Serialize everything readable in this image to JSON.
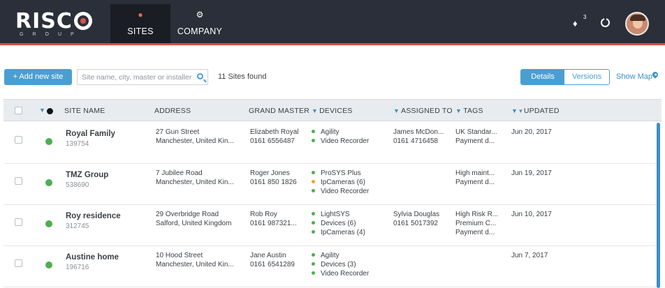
{
  "brand": {
    "logo_text": "RISC",
    "logo_sub": "GROUP"
  },
  "nav": {
    "tabs": [
      {
        "label": "SITES",
        "icon": "map-pin-icon",
        "active": true
      },
      {
        "label": "COMPANY",
        "icon": "gear-icon",
        "active": false
      }
    ],
    "notifications_count": "3"
  },
  "toolbar": {
    "add_label": "+ Add new site",
    "search_placeholder": "Site name, city, master or installer",
    "sites_found": "11 Sites found",
    "details_label": "Details",
    "versions_label": "Versions",
    "show_map_label": "Show Map"
  },
  "table": {
    "headers": {
      "site_name": "SITE NAME",
      "address": "ADDRESS",
      "grand_master": "GRAND MASTER",
      "devices": "DEVICES",
      "assigned_to": "ASSIGNED TO",
      "tags": "TAGS",
      "updated": "UPDATED"
    },
    "rows": [
      {
        "name": "Royal Family",
        "id": "139754",
        "address1": "27 Gun Street",
        "address2": "Manchester, United Kin...",
        "master_name": "Elizabeth Royal",
        "master_phone": "0161 6556487",
        "devices": [
          "Agility",
          "Video Recorder"
        ],
        "assigned_name": "James McDon...",
        "assigned_phone": "0161 4716458",
        "tags": [
          "UK Standar...",
          "Payment d..."
        ],
        "updated": "Jun 20, 2017"
      },
      {
        "name": "TMZ Group",
        "id": "538690",
        "address1": "7 Jubilee Road",
        "address2": "Manchester, United Kin...",
        "master_name": "Roger Jones",
        "master_phone": "0161 850 1826",
        "devices": [
          "ProSYS Plus",
          "IpCameras (6)",
          "Video Recorder"
        ],
        "assigned_name": "",
        "assigned_phone": "",
        "tags": [
          "High maint...",
          "Payment d..."
        ],
        "updated": "Jun 19, 2017"
      },
      {
        "name": "Roy residence",
        "id": "312745",
        "address1": "29 Overbridge Road",
        "address2": "Salford, United Kingdom",
        "master_name": "Rob Roy",
        "master_phone": "0161 987321...",
        "devices": [
          "LightSYS",
          "Devices (6)",
          "IpCameras (4)"
        ],
        "assigned_name": "Sylvia Douglas",
        "assigned_phone": "0161 5017392",
        "tags": [
          "High Risk R...",
          "Premium C...",
          "Payment d..."
        ],
        "updated": "Jun 10, 2017"
      },
      {
        "name": "Austine home",
        "id": "196716",
        "address1": "10 Hood Street",
        "address2": "Manchester, United Kin...",
        "master_name": "Jane Austin",
        "master_phone": "0161 6541289",
        "devices": [
          "Agility",
          "Devices (3)",
          "Video Recorder"
        ],
        "assigned_name": "",
        "assigned_phone": "",
        "tags": [],
        "updated": "Jun 7, 2017"
      }
    ]
  },
  "colors": {
    "nav_bg": "#2b2f3a",
    "accent": "#d9534f",
    "primary": "#4a9fd1",
    "status_ok": "#4caf50",
    "status_warn": "#f0a030"
  }
}
